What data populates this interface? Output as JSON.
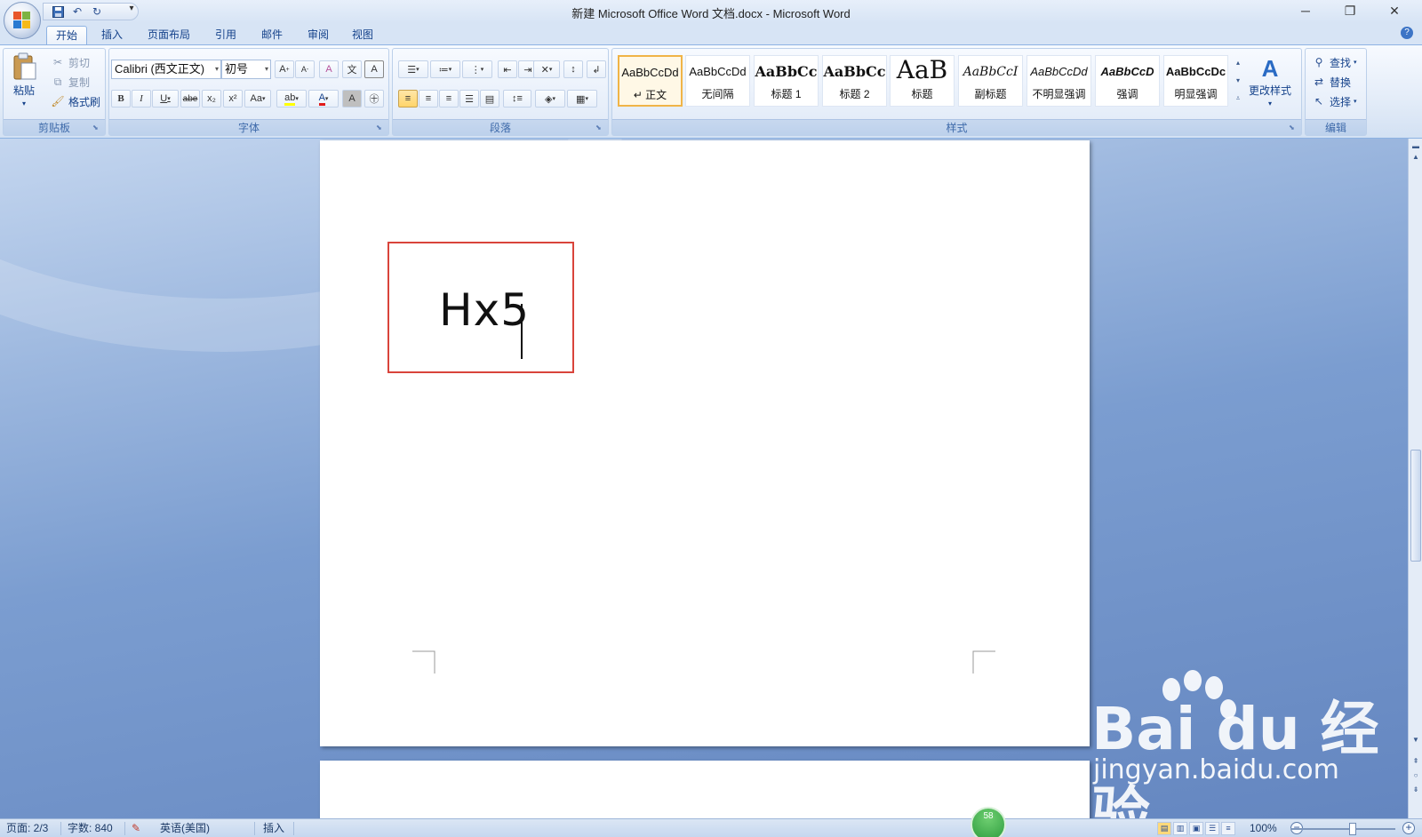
{
  "window": {
    "title": "新建 Microsoft Office Word 文档.docx - Microsoft Word",
    "minimize": "─",
    "restore": "❐",
    "close": "✕"
  },
  "qat": {
    "save_icon": "save-icon",
    "undo_icon": "undo-icon",
    "redo_icon": "redo-icon",
    "more": "▾"
  },
  "tabs": [
    "开始",
    "插入",
    "页面布局",
    "引用",
    "邮件",
    "审阅",
    "视图"
  ],
  "help": "?",
  "clipboard": {
    "paste": "粘贴",
    "cut": "剪切",
    "copy": "复制",
    "format_painter": "格式刷",
    "label": "剪贴板"
  },
  "font": {
    "family": "Calibri (西文正文)",
    "size": "初号",
    "bold": "B",
    "italic": "I",
    "underline": "U",
    "strike": "abe",
    "subscript": "x₂",
    "superscript": "x²",
    "case": "Aa",
    "highlight": "ab",
    "color": "A",
    "shade": "A",
    "enclose": "㊉",
    "grow": "A",
    "shrink": "A",
    "clear": "A",
    "pinyin": "文",
    "border": "A",
    "label": "字体",
    "color_hex": "#e01a1a",
    "highlight_hex": "#ffff00"
  },
  "paragraph": {
    "label": "段落"
  },
  "styles": {
    "label": "样式",
    "change": "更改样式",
    "tiles": [
      {
        "sample": "AaBbCcDd",
        "name": "↵ 正文"
      },
      {
        "sample": "AaBbCcDd",
        "name": "无间隔"
      },
      {
        "sample": "AaBbCc",
        "name": "标题 1"
      },
      {
        "sample": "AaBbCc",
        "name": "标题 2"
      },
      {
        "sample": "AaB",
        "name": "标题"
      },
      {
        "sample": "AaBbCcI",
        "name": "副标题"
      },
      {
        "sample": "AaBbCcDd",
        "name": "不明显强调"
      },
      {
        "sample": "AaBbCcD",
        "name": "强调"
      },
      {
        "sample": "AaBbCcDc",
        "name": "明显强调"
      }
    ]
  },
  "editing": {
    "find": "查找",
    "replace": "替换",
    "select": "选择",
    "label": "编辑"
  },
  "document": {
    "text": "Hx5",
    "textbox_border": "#d9443b"
  },
  "watermark": {
    "logo": "Bai du 经验",
    "url": "jingyan.baidu.com"
  },
  "status": {
    "page": "页面: 2/3",
    "words": "字数: 840",
    "language": "英语(美国)",
    "mode": "插入",
    "zoom": "100%",
    "badge": "58"
  }
}
